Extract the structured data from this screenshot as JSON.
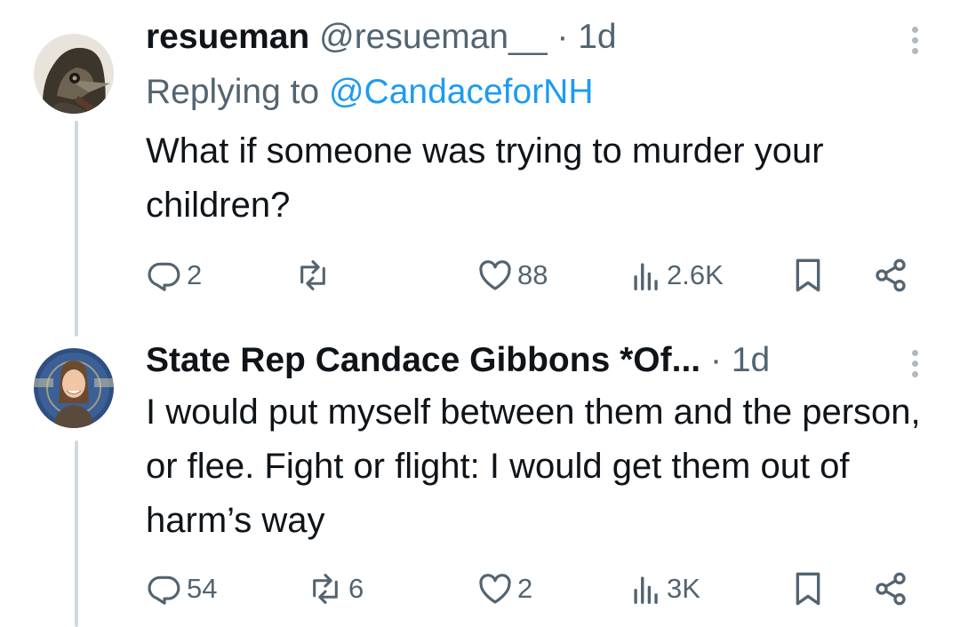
{
  "tweets": [
    {
      "display_name": "resueman",
      "handle": "@resueman__",
      "separator": "·",
      "time": "1d",
      "replying_prefix": "Replying to",
      "replying_to": "@CandaceforNH",
      "text": "What if someone was trying to murder your children?",
      "stats": {
        "replies": "2",
        "reposts": "",
        "likes": "88",
        "views": "2.6K"
      },
      "avatar_icon": "hooded-figure-avatar"
    },
    {
      "display_name": "State Rep Candace Gibbons *Of...",
      "separator": "·",
      "time": "1d",
      "text": "I would put myself between them and the person, or flee. Fight or flight: I would get them out of harm’s way",
      "stats": {
        "replies": "54",
        "reposts": "6",
        "likes": "2",
        "views": "3K"
      },
      "avatar_icon": "profile-photo-avatar"
    }
  ],
  "colors": {
    "text": "#0f1419",
    "muted": "#536471",
    "link": "#1d9bf0",
    "thread_line": "#cfd9de"
  }
}
